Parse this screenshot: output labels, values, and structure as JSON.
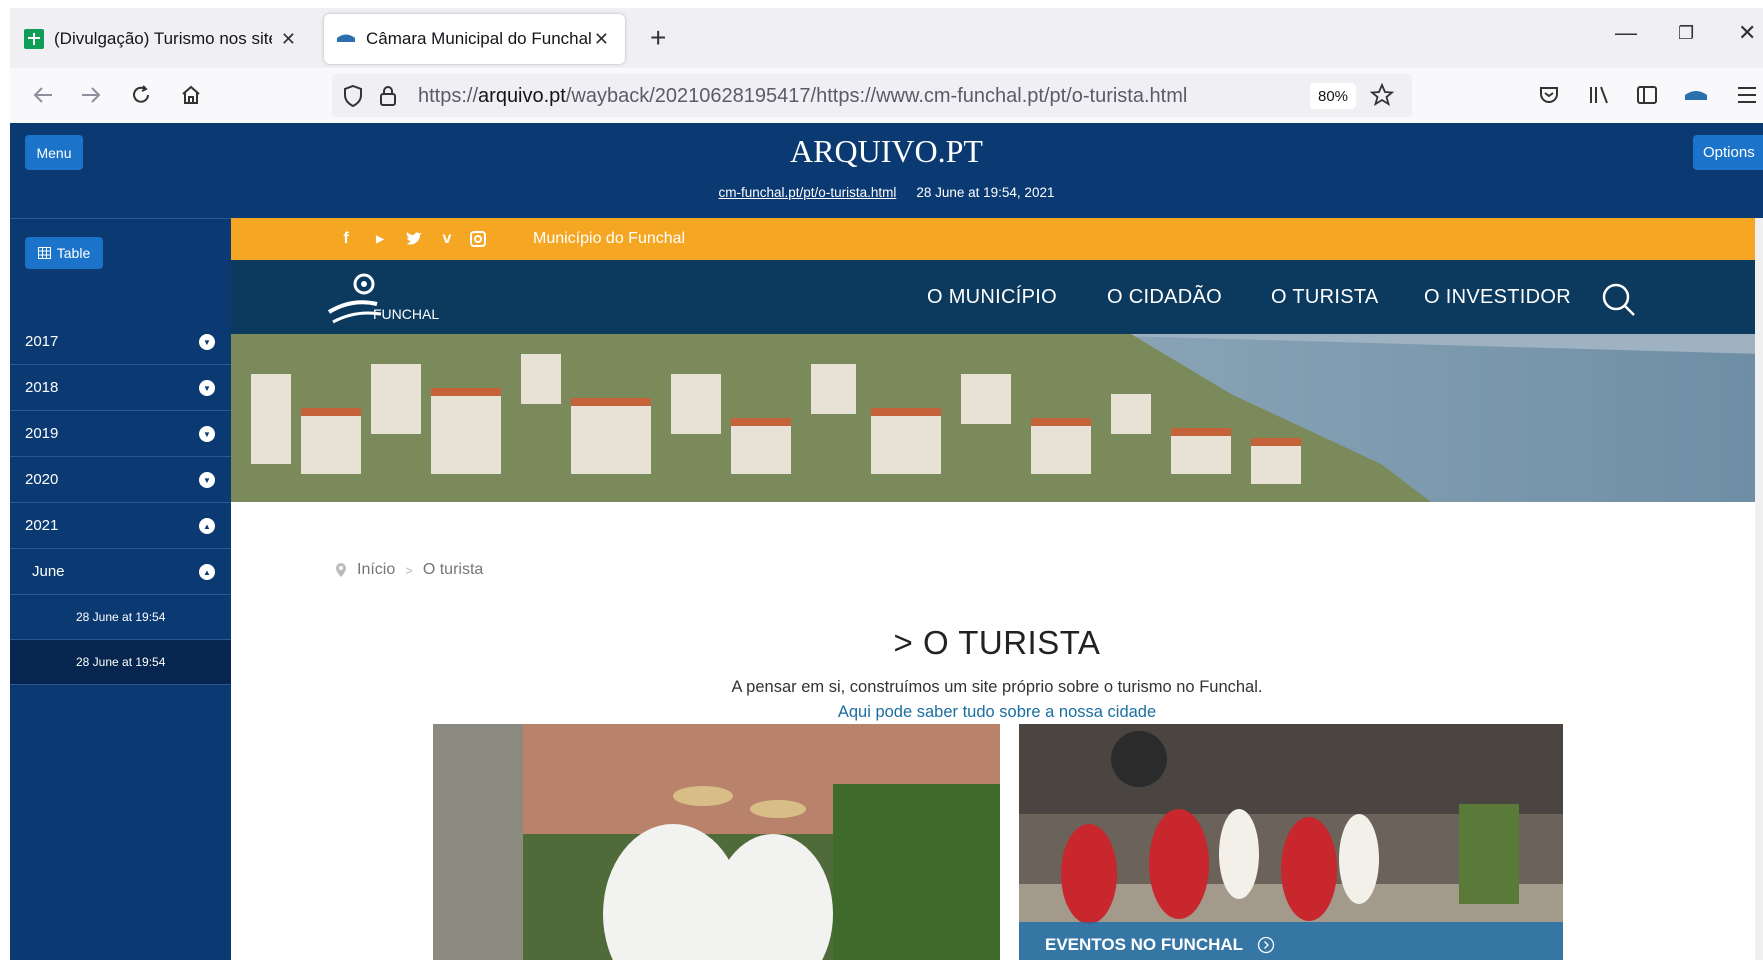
{
  "browser": {
    "tabs": [
      {
        "label": "(Divulgação) Turismo nos sites d",
        "state": "inactive",
        "favicon": "google-sheets-icon"
      },
      {
        "label": "Câmara Municipal do Funchal - A",
        "state": "active",
        "favicon": "arquivo-icon"
      }
    ],
    "new_tab": "+",
    "window_controls": {
      "minimize": "—",
      "restore": "❐",
      "close": "✕"
    },
    "url_prefix": "https://",
    "url_host": "arquivo.pt",
    "url_path": "/wayback/20210628195417/https://www.cm-funchal.pt/pt/o-turista.html",
    "zoom": "80%"
  },
  "arquivo": {
    "menu_label": "Menu",
    "options_label": "Options",
    "logo": "ARQUIVO.PT",
    "archived_url": "cm-funchal.pt/pt/o-turista.html",
    "archived_date": "28 June at 19:54, 2021"
  },
  "sidebar": {
    "table_label": "Table",
    "years": [
      "2017",
      "2018",
      "2019",
      "2020",
      "2021"
    ],
    "month": "June",
    "dates": [
      "28 June at 19:54",
      "28 June at 19:54"
    ]
  },
  "site": {
    "topbar_label": "Município do Funchal",
    "logo_text": "FUNCHAL",
    "nav": [
      "O MUNICÍPIO",
      "O CIDADÃO",
      "O TURISTA",
      "O INVESTIDOR"
    ],
    "breadcrumb": {
      "home": "Início",
      "separator": ">",
      "current": "O turista"
    },
    "title": ">  O TURISTA",
    "description": "A pensar em si, construímos um site próprio sobre o turismo no Funchal.",
    "link": "Aqui pode saber tudo sobre a nossa cidade",
    "cards": [
      {
        "caption": ""
      },
      {
        "caption": "EVENTOS NO FUNCHAL"
      }
    ]
  },
  "colors": {
    "arquivo_blue": "#0b3a73",
    "button_blue": "#1b74c9",
    "orange_bar": "#f5a623",
    "site_nav": "#0c3a5f"
  }
}
